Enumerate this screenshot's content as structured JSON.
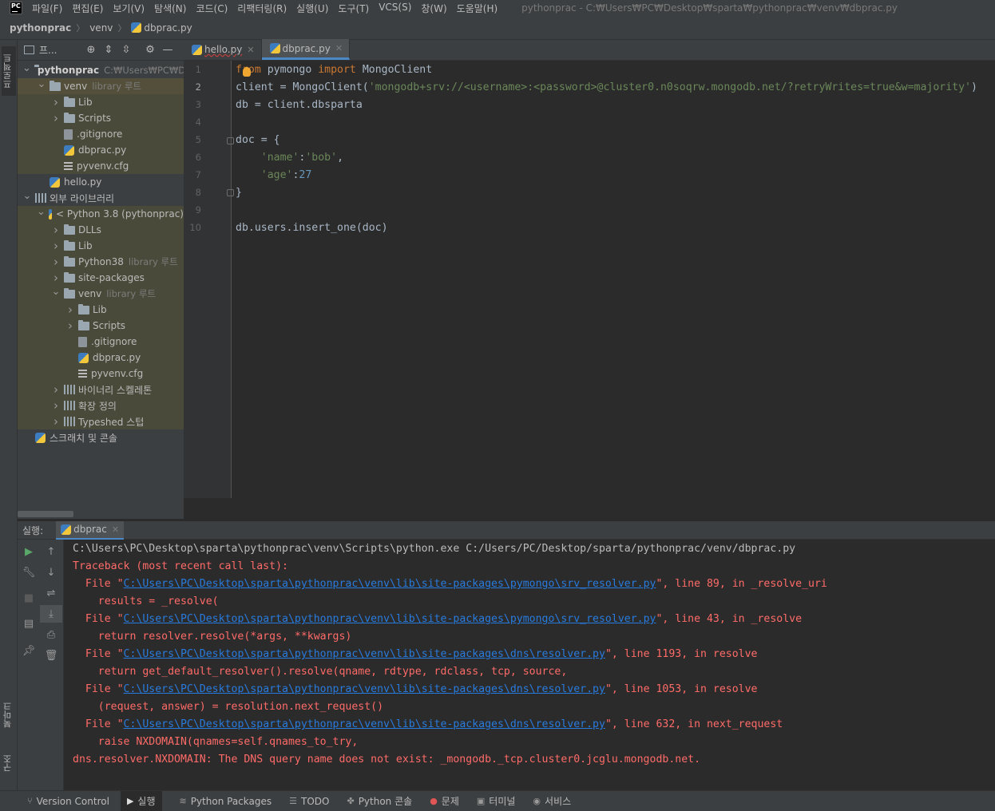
{
  "menu": [
    "파일(F)",
    "편집(E)",
    "보기(V)",
    "탐색(N)",
    "코드(C)",
    "리팩터링(R)",
    "실행(U)",
    "도구(T)",
    "VCS(S)",
    "창(W)",
    "도움말(H)"
  ],
  "window_title": "pythonprac - C:₩Users₩PC₩Desktop₩sparta₩pythonprac₩venv₩dbprac.py",
  "breadcrumb": {
    "project": "pythonprac",
    "folder": "venv",
    "file": "dbprac.py"
  },
  "side_tabs": {
    "project": "프로젝트",
    "bookmarks": "북마크",
    "structure": "구조"
  },
  "project_panel": {
    "title": "프..."
  },
  "tree": [
    {
      "label": "pythonprac",
      "extra": "C:₩Users₩PC₩De",
      "type": "folder",
      "depth": 0,
      "arrow": "down",
      "bold": true
    },
    {
      "label": "venv",
      "extra": "library 루트",
      "type": "folder",
      "depth": 1,
      "arrow": "down",
      "sel": true
    },
    {
      "label": "Lib",
      "type": "folder",
      "depth": 2,
      "arrow": "right"
    },
    {
      "label": "Scripts",
      "type": "folder",
      "depth": 2,
      "arrow": "right"
    },
    {
      "label": ".gitignore",
      "type": "file",
      "depth": 2,
      "arrow": ""
    },
    {
      "label": "dbprac.py",
      "type": "py",
      "depth": 2,
      "arrow": ""
    },
    {
      "label": "pyvenv.cfg",
      "type": "cfg",
      "depth": 2,
      "arrow": ""
    },
    {
      "label": "hello.py",
      "type": "py",
      "depth": 1,
      "arrow": ""
    },
    {
      "label": "외부 라이브러리",
      "type": "lib",
      "depth": 0,
      "arrow": "down"
    },
    {
      "label": "< Python 3.8 (pythonprac)",
      "type": "py",
      "depth": 1,
      "arrow": "down"
    },
    {
      "label": "DLLs",
      "type": "folder",
      "depth": 2,
      "arrow": "right"
    },
    {
      "label": "Lib",
      "type": "folder",
      "depth": 2,
      "arrow": "right"
    },
    {
      "label": "Python38",
      "extra": "library 루트",
      "type": "folder",
      "depth": 2,
      "arrow": "right"
    },
    {
      "label": "site-packages",
      "type": "folder",
      "depth": 2,
      "arrow": "right"
    },
    {
      "label": "venv",
      "extra": "library 루트",
      "type": "folder",
      "depth": 2,
      "arrow": "down"
    },
    {
      "label": "Lib",
      "type": "folder",
      "depth": 3,
      "arrow": "right"
    },
    {
      "label": "Scripts",
      "type": "folder",
      "depth": 3,
      "arrow": "right"
    },
    {
      "label": ".gitignore",
      "type": "file",
      "depth": 3,
      "arrow": ""
    },
    {
      "label": "dbprac.py",
      "type": "py",
      "depth": 3,
      "arrow": ""
    },
    {
      "label": "pyvenv.cfg",
      "type": "cfg",
      "depth": 3,
      "arrow": ""
    },
    {
      "label": "바이너리 스켈레톤",
      "type": "lib",
      "depth": 2,
      "arrow": "right"
    },
    {
      "label": "확장 정의",
      "type": "lib",
      "depth": 2,
      "arrow": "right"
    },
    {
      "label": "Typeshed 스텁",
      "type": "lib",
      "depth": 2,
      "arrow": "right"
    },
    {
      "label": "스크래치 및 콘솔",
      "type": "py",
      "depth": 0,
      "arrow": ""
    }
  ],
  "editor_tabs": [
    {
      "label": "hello.py",
      "active": false
    },
    {
      "label": "dbprac.py",
      "active": true
    }
  ],
  "code": [
    [
      {
        "t": "from",
        "c": "kw"
      },
      {
        "t": " pymongo ",
        "c": ""
      },
      {
        "t": "import",
        "c": "kw"
      },
      {
        "t": " MongoClient",
        "c": ""
      }
    ],
    [
      {
        "t": "client = MongoClient(",
        "c": ""
      },
      {
        "t": "'mongodb+srv://<username>:<password>@cluster0.n0soqrw.mongodb.net/?retryWrites=true&w=majority'",
        "c": "str"
      },
      {
        "t": ")",
        "c": ""
      }
    ],
    [
      {
        "t": "db = client.dbsparta",
        "c": ""
      }
    ],
    [],
    [
      {
        "t": "doc = {",
        "c": ""
      }
    ],
    [
      {
        "t": "    ",
        "c": ""
      },
      {
        "t": "'name'",
        "c": "str"
      },
      {
        "t": ":",
        "c": ""
      },
      {
        "t": "'bob'",
        "c": "str"
      },
      {
        "t": ",",
        "c": ""
      }
    ],
    [
      {
        "t": "    ",
        "c": ""
      },
      {
        "t": "'age'",
        "c": "str"
      },
      {
        "t": ":",
        "c": ""
      },
      {
        "t": "27",
        "c": "num"
      }
    ],
    [
      {
        "t": "}",
        "c": ""
      }
    ],
    [],
    [
      {
        "t": "db.users.insert_one(doc)",
        "c": ""
      }
    ]
  ],
  "current_line": 2,
  "run": {
    "label": "실행:",
    "tab": "dbprac"
  },
  "console": [
    [
      {
        "t": "C:\\Users\\PC\\Desktop\\sparta\\pythonprac\\venv\\Scripts\\python.exe C:/Users/PC/Desktop/sparta/pythonprac/venv/dbprac.py",
        "c": "normal"
      }
    ],
    [
      {
        "t": "Traceback (most recent call last):",
        "c": "err"
      }
    ],
    [
      {
        "t": "  File \"",
        "c": "err"
      },
      {
        "t": "C:\\Users\\PC\\Desktop\\sparta\\pythonprac\\venv\\lib\\site-packages\\pymongo\\srv_resolver.py",
        "c": "link"
      },
      {
        "t": "\", line 89, in _resolve_uri",
        "c": "err"
      }
    ],
    [
      {
        "t": "    results = _resolve(",
        "c": "err"
      }
    ],
    [
      {
        "t": "  File \"",
        "c": "err"
      },
      {
        "t": "C:\\Users\\PC\\Desktop\\sparta\\pythonprac\\venv\\lib\\site-packages\\pymongo\\srv_resolver.py",
        "c": "link"
      },
      {
        "t": "\", line 43, in _resolve",
        "c": "err"
      }
    ],
    [
      {
        "t": "    return resolver.resolve(*args, **kwargs)",
        "c": "err"
      }
    ],
    [
      {
        "t": "  File \"",
        "c": "err"
      },
      {
        "t": "C:\\Users\\PC\\Desktop\\sparta\\pythonprac\\venv\\lib\\site-packages\\dns\\resolver.py",
        "c": "link"
      },
      {
        "t": "\", line 1193, in resolve",
        "c": "err"
      }
    ],
    [
      {
        "t": "    return get_default_resolver().resolve(qname, rdtype, rdclass, tcp, source,",
        "c": "err"
      }
    ],
    [
      {
        "t": "  File \"",
        "c": "err"
      },
      {
        "t": "C:\\Users\\PC\\Desktop\\sparta\\pythonprac\\venv\\lib\\site-packages\\dns\\resolver.py",
        "c": "link"
      },
      {
        "t": "\", line 1053, in resolve",
        "c": "err"
      }
    ],
    [
      {
        "t": "    (request, answer) = resolution.next_request()",
        "c": "err"
      }
    ],
    [
      {
        "t": "  File \"",
        "c": "err"
      },
      {
        "t": "C:\\Users\\PC\\Desktop\\sparta\\pythonprac\\venv\\lib\\site-packages\\dns\\resolver.py",
        "c": "link"
      },
      {
        "t": "\", line 632, in next_request",
        "c": "err"
      }
    ],
    [
      {
        "t": "    raise NXDOMAIN(qnames=self.qnames_to_try,",
        "c": "err"
      }
    ],
    [
      {
        "t": "dns.resolver.NXDOMAIN: The DNS query name does not exist: _mongodb._tcp.cluster0.jcglu.mongodb.net.",
        "c": "err"
      }
    ]
  ],
  "statusbar": [
    {
      "label": "Version Control",
      "icon": "branch-icon",
      "glyph": "⑂"
    },
    {
      "label": "실행",
      "icon": "run-icon",
      "glyph": "▶",
      "active": true
    },
    {
      "label": "Python Packages",
      "icon": "layers-icon",
      "glyph": "≋"
    },
    {
      "label": "TODO",
      "icon": "list-icon",
      "glyph": "☰"
    },
    {
      "label": "Python 콘솔",
      "icon": "python-console-icon",
      "glyph": "✤"
    },
    {
      "label": "문제",
      "icon": "error-icon",
      "glyph": "●"
    },
    {
      "label": "터미널",
      "icon": "terminal-icon",
      "glyph": "▣"
    },
    {
      "label": "서비스",
      "icon": "services-icon",
      "glyph": "◉"
    }
  ]
}
